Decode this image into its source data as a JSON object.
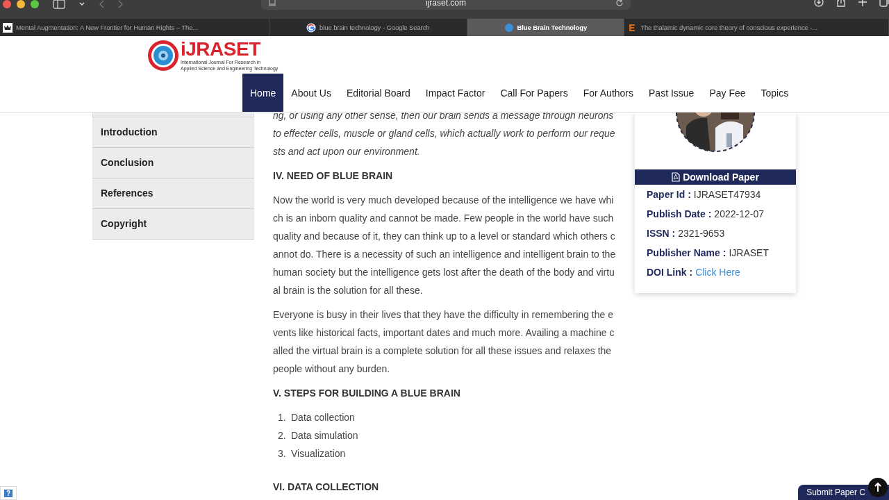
{
  "browser": {
    "address": "ijraset.com",
    "tabs": [
      {
        "title": "Mental Augmentation: A New Frontier for Human Rights – The...",
        "selected": false
      },
      {
        "title": "blue brain technology - Google Search",
        "selected": false
      },
      {
        "title": "Blue Brain Technology",
        "selected": true
      },
      {
        "title": "The thalamic dynamic core theory of conscious experience -...",
        "selected": false
      }
    ]
  },
  "site": {
    "logo": {
      "name": "iJRASET",
      "tagline": [
        "International Journal For Research in",
        "Applied Science and Engineering Technology"
      ]
    },
    "nav": [
      {
        "label": "Home",
        "selected": true
      },
      {
        "label": "About Us",
        "selected": false
      },
      {
        "label": "Editorial Board",
        "selected": false
      },
      {
        "label": "Impact Factor",
        "selected": false
      },
      {
        "label": "Call For Papers",
        "selected": false
      },
      {
        "label": "For Authors",
        "selected": false
      },
      {
        "label": "Past Issue",
        "selected": false
      },
      {
        "label": "Pay Fee",
        "selected": false
      },
      {
        "label": "Topics",
        "selected": false
      }
    ]
  },
  "sidebar": {
    "items": [
      {
        "label": "Introduction"
      },
      {
        "label": "Conclusion"
      },
      {
        "label": "References"
      },
      {
        "label": "Copyright"
      }
    ]
  },
  "article": {
    "blocks": [
      {
        "kind": "quote",
        "text": "ng, or using any other sense, then our brain sends a message through neurons to effecter cells, muscle or gland cells, which actually work to perform our requests and act upon our environment."
      },
      {
        "kind": "heading",
        "text": "IV. NEED OF BLUE BRAIN"
      },
      {
        "kind": "paragraph",
        "text": "Now the world is very much developed because of the intelligence we have which is an inborn quality and cannot be made. Few people in the world have such quality and because of it, they can think up to a level or standard which others cannot do. There is a necessity of such an intelligence and intelligent brain to the human society but the intelligence gets lost after the death of the body and virtual brain is the solution for all these."
      },
      {
        "kind": "paragraph",
        "text": "Everyone is busy in their lives that they have the difficulty in remembering the events like historical facts, important dates and much more. Availing a machine called the virtual brain is a complete solution for all these issues and relaxes the people without any burden."
      },
      {
        "kind": "heading",
        "text": "V. STEPS FOR BUILDING A BLUE BRAIN"
      },
      {
        "kind": "list",
        "items": [
          {
            "number": "1.",
            "text": "Data collection"
          },
          {
            "number": "2.",
            "text": "Data simulation"
          },
          {
            "number": "3.",
            "text": "Visualization"
          }
        ]
      },
      {
        "kind": "heading",
        "text": "VI. DATA COLLECTION"
      }
    ]
  },
  "card": {
    "download": "Download Paper",
    "fields": [
      {
        "label": "Paper Id :",
        "value": "IJRASET47934",
        "kind": "text"
      },
      {
        "label": "Publish Date :",
        "value": "2022-12-07",
        "kind": "text"
      },
      {
        "label": "ISSN :",
        "value": "2321-9653",
        "kind": "text"
      },
      {
        "label": "Publisher Name :",
        "value": "IJRASET",
        "kind": "text"
      },
      {
        "label": "DOI Link :",
        "value": "Click Here",
        "kind": "link"
      }
    ]
  },
  "footer": {
    "help": "?",
    "submit": "Submit Paper C"
  }
}
